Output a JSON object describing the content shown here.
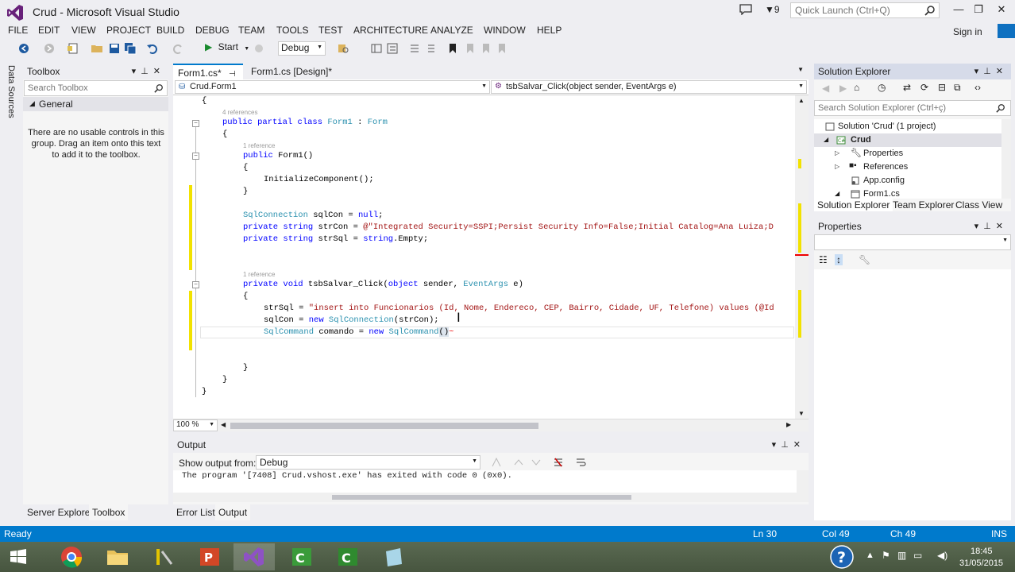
{
  "window": {
    "title": "Crud - Microsoft Visual Studio",
    "notification_count": "9",
    "quick_launch_placeholder": "Quick Launch (Ctrl+Q)",
    "sign_in": "Sign in"
  },
  "menu": [
    "FILE",
    "EDIT",
    "VIEW",
    "PROJECT",
    "BUILD",
    "DEBUG",
    "TEAM",
    "TOOLS",
    "TEST",
    "ARCHITECTURE",
    "ANALYZE",
    "WINDOW",
    "HELP"
  ],
  "toolbar": {
    "start_label": "Start",
    "configuration": "Debug"
  },
  "left_tabs": {
    "data_sources": "Data Sources"
  },
  "toolbox": {
    "title": "Toolbox",
    "search_placeholder": "Search Toolbox",
    "group": "General",
    "empty_message": "There are no usable controls in this group. Drag an item onto this text to add it to the toolbox.",
    "bottom_tabs": [
      "Server Explorer",
      "Toolbox"
    ]
  },
  "editor": {
    "tabs": [
      {
        "label": "Form1.cs*",
        "active": true
      },
      {
        "label": "Form1.cs [Design]*",
        "active": false
      }
    ],
    "class_nav": "Crud.Form1",
    "member_nav": "tsbSalvar_Click(object sender, EventArgs e)",
    "zoom": "100 %",
    "lens": {
      "class_refs": "4 references",
      "ctor_refs": "1 reference",
      "method_refs": "1 reference"
    },
    "code": {
      "l_open_ns": "{",
      "class_kw": "public partial class ",
      "class_name": "Form1",
      "class_sep": " : ",
      "class_base": "Form",
      "l_open_class": "{",
      "ctor_kw": "public ",
      "ctor_name": "Form1()",
      "l_open_ctor": "{",
      "init_call": "InitializeComponent();",
      "l_close_ctor": "}",
      "sqlcon_type": "SqlConnection",
      "sqlcon_rest": " sqlCon = ",
      "sqlcon_null": "null",
      "sqlcon_end": ";",
      "strcon_kw": "private string",
      "strcon_rest": " strCon = ",
      "strcon_val": "@\"Integrated Security=SSPI;Persist Security Info=False;Initial Catalog=Ana Luiza;D",
      "strsql_kw": "private string",
      "strsql_rest": " strSql = ",
      "strsql_string": "string",
      "strsql_end": ".Empty;",
      "method_kw": "private void",
      "method_name": " tsbSalvar_Click(",
      "method_obj": "object",
      "method_mid": " sender, ",
      "method_evt": "EventArgs",
      "method_end": " e)",
      "l_open_method": "{",
      "sql_assign": "strSql = ",
      "sql_string": "\"insert into Funcionarios (Id, Nome, Endereco, CEP, Bairro, Cidade, UF, Telefone) values (@Id",
      "newcon_a": "sqlCon = ",
      "newcon_new": "new",
      "newcon_type": " SqlConnection",
      "newcon_end": "(strCon);",
      "cmd_type": "SqlCommand",
      "cmd_mid": " comando = ",
      "cmd_new": "new",
      "cmd_ctor": " SqlCommand",
      "cmd_end": "()",
      "l_close_method": "}",
      "l_close_class": "}",
      "l_close_ns": "}"
    }
  },
  "output": {
    "title": "Output",
    "show_from_label": "Show output from:",
    "source": "Debug",
    "text": "The program '[7408] Crud.vshost.exe' has exited with code 0 (0x0).",
    "bottom_tabs": [
      "Error List",
      "Output"
    ]
  },
  "solution_explorer": {
    "title": "Solution Explorer",
    "search_placeholder": "Search Solution Explorer (Ctrl+ç)",
    "tree": [
      {
        "label": "Solution 'Crud' (1 project)"
      },
      {
        "label": "Crud"
      },
      {
        "label": "Properties"
      },
      {
        "label": "References"
      },
      {
        "label": "App.config"
      },
      {
        "label": "Form1.cs"
      }
    ],
    "tabs": [
      "Solution Explorer",
      "Team Explorer",
      "Class View"
    ]
  },
  "properties": {
    "title": "Properties"
  },
  "status": {
    "state": "Ready",
    "line": "Ln 30",
    "col": "Col 49",
    "ch": "Ch 49",
    "mode": "INS"
  },
  "taskbar": {
    "time": "18:45",
    "date": "31/05/2015"
  },
  "colors": {
    "accent": "#007acc",
    "vs_purple": "#68217a",
    "keyword": "#0000ff",
    "type": "#2b91af",
    "string": "#a31515"
  }
}
